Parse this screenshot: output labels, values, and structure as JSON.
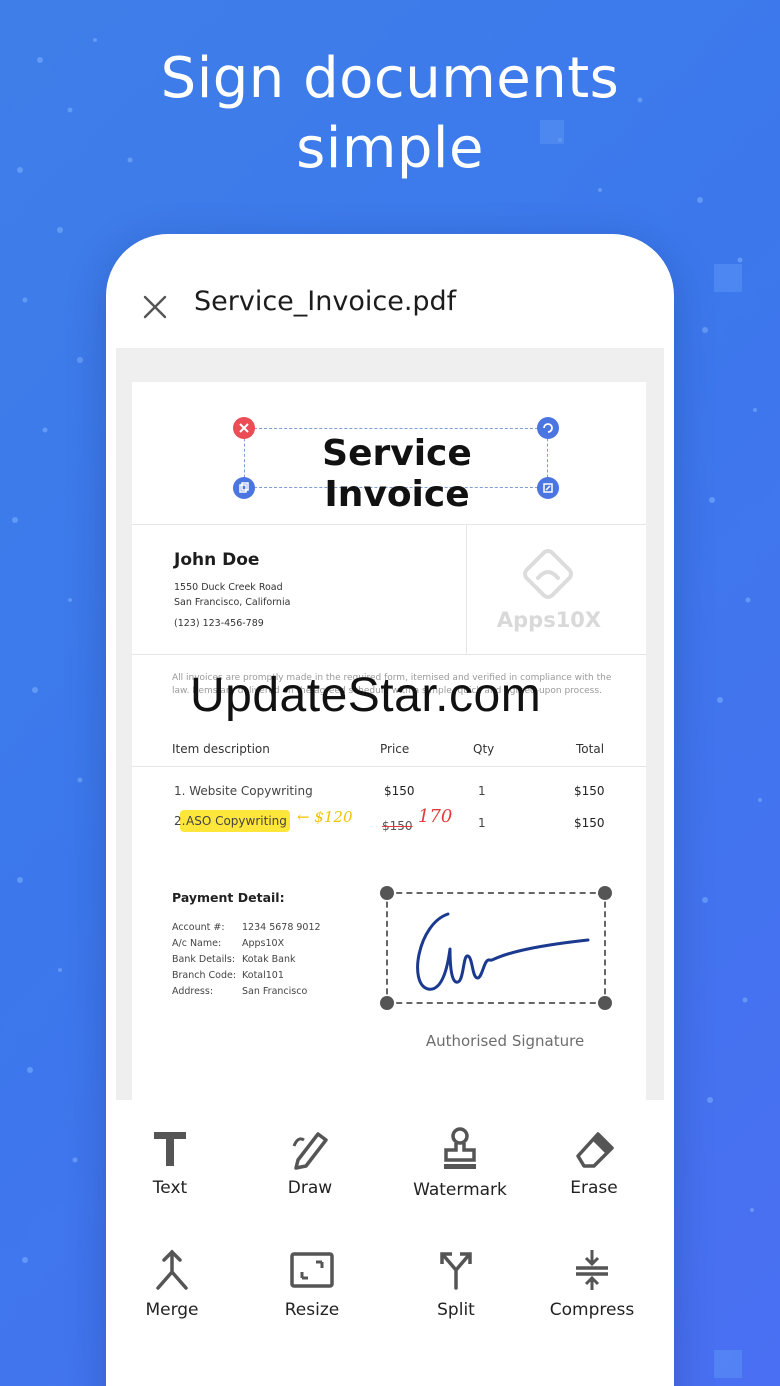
{
  "promo": {
    "title_line1": "Sign documents",
    "title_line2": "simple"
  },
  "header": {
    "file_name": "Service_Invoice.pdf"
  },
  "document": {
    "title": "Service Invoice",
    "client": {
      "name": "John Doe",
      "address1": "1550 Duck Creek Road",
      "address2": "San Francisco, California",
      "phone": "(123) 123-456-789"
    },
    "brand": "Apps10X",
    "blurb": "All invoices are promptly made in the required form, itemised and verified in compliance with the law. Items are delivered on the agreed schedule with a simple, quick and agreed-upon process.",
    "table": {
      "headers": [
        "Item description",
        "Price",
        "Qty",
        "Total"
      ],
      "rows": [
        {
          "item": "1. Website Copywriting",
          "price": "$150",
          "qty": "1",
          "total": "$150"
        },
        {
          "num": "2.",
          "item": "ASO Copywriting",
          "note": "← $120",
          "price": "$150",
          "price_new": "170",
          "qty": "1",
          "total": "$150"
        }
      ]
    },
    "payment": {
      "title": "Payment Detail:",
      "rows": [
        {
          "k": "Account #:",
          "v": "1234 5678 9012"
        },
        {
          "k": "A/c Name:",
          "v": "Apps10X"
        },
        {
          "k": "Bank Details:",
          "v": "Kotak Bank"
        },
        {
          "k": "Branch Code:",
          "v": "Kotal101"
        },
        {
          "k": "Address:",
          "v": "San Francisco"
        }
      ]
    },
    "signature_label": "Authorised Signature"
  },
  "watermark": "UpdateStar.com",
  "tools": [
    {
      "label": "Text",
      "icon": "text-icon"
    },
    {
      "label": "Draw",
      "icon": "draw-icon"
    },
    {
      "label": "Watermark",
      "icon": "stamp-icon"
    },
    {
      "label": "Erase",
      "icon": "eraser-icon"
    },
    {
      "label": "Merge",
      "icon": "merge-icon"
    },
    {
      "label": "Resize",
      "icon": "resize-icon"
    },
    {
      "label": "Split",
      "icon": "split-icon"
    },
    {
      "label": "Compress",
      "icon": "compress-icon"
    }
  ],
  "colors": {
    "background": "#3f7ee9",
    "accent": "#4b75e0",
    "delete": "#ec4c55",
    "highlight": "#ffe63a",
    "signature_ink": "#1b3a8f"
  }
}
